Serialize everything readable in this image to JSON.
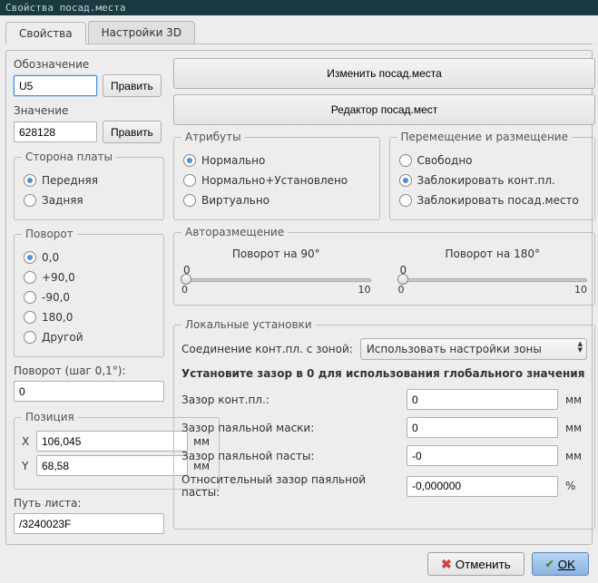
{
  "window": {
    "title": "Свойства посад.места"
  },
  "tabs": {
    "properties": "Свойства",
    "settings3d": "Настройки 3D"
  },
  "left": {
    "designation_label": "Обозначение",
    "designation_value": "U5",
    "edit_btn": "Править",
    "value_label": "Значение",
    "value_value": "628128",
    "side_legend": "Сторона платы",
    "side_front": "Передняя",
    "side_back": "Задняя",
    "rotation_legend": "Поворот",
    "rot_0": "0,0",
    "rot_90": "+90,0",
    "rot_m90": "-90,0",
    "rot_180": "180,0",
    "rot_other": "Другой",
    "rotation_step_label": "Поворот (шаг 0,1°):",
    "rotation_step_value": "0",
    "position_legend": "Позиция",
    "pos_x_label": "X",
    "pos_x_value": "106,045",
    "pos_y_label": "Y",
    "pos_y_value": "68,58",
    "pos_unit": "мм",
    "sheet_path_label": "Путь листа:",
    "sheet_path_value": "/3240023F"
  },
  "right": {
    "change_btn": "Изменить посад.места",
    "editor_btn": "Редактор посад.мест",
    "attributes_legend": "Атрибуты",
    "attr_normal": "Нормально",
    "attr_normal_installed": "Нормально+Установлено",
    "attr_virtual": "Виртуально",
    "move_legend": "Перемещение и размещение",
    "move_free": "Свободно",
    "move_lock_pad": "Заблокировать конт.пл.",
    "move_lock_fp": "Заблокировать посад.место",
    "autoplace_legend": "Авторазмещение",
    "rot90_label": "Поворот на 90°",
    "rot180_label": "Поворот на 180°",
    "slider_val": "0",
    "slider_min": "0",
    "slider_max": "10",
    "local_legend": "Локальные установки",
    "zone_conn_label": "Соединение конт.пл. с зоной:",
    "zone_conn_value": "Использовать настройки зоны",
    "note": "Установите зазор в 0 для использования глобального значения",
    "clearance_label": "Зазор конт.пл.:",
    "clearance_value": "0",
    "mask_label": "Зазор паяльной маски:",
    "mask_value": "0",
    "paste_label": "Зазор паяльной пасты:",
    "paste_value": "-0",
    "paste_ratio_label": "Относительный зазор паяльной пасты:",
    "paste_ratio_value": "-0,000000",
    "unit_mm": "мм",
    "unit_pct": "%"
  },
  "buttons": {
    "cancel": "Отменить",
    "ok": "OK"
  }
}
